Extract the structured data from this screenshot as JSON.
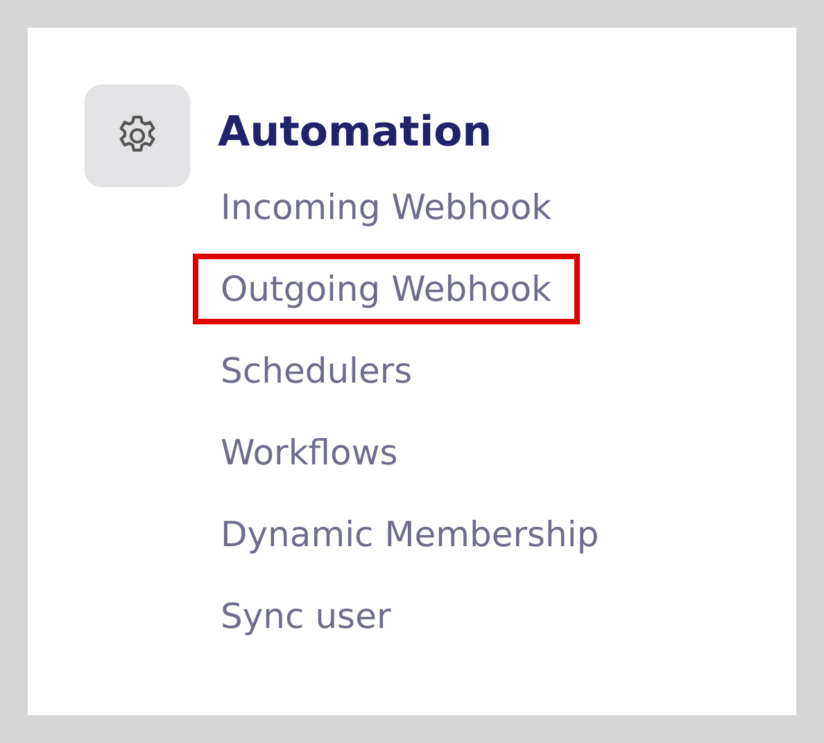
{
  "section": {
    "title": "Automation"
  },
  "items": [
    {
      "label": "Incoming Webhook",
      "highlighted": false
    },
    {
      "label": "Outgoing Webhook",
      "highlighted": true
    },
    {
      "label": "Schedulers",
      "highlighted": false
    },
    {
      "label": "Workflows",
      "highlighted": false
    },
    {
      "label": "Dynamic Membership",
      "highlighted": false
    },
    {
      "label": "Sync user",
      "highlighted": false
    }
  ]
}
